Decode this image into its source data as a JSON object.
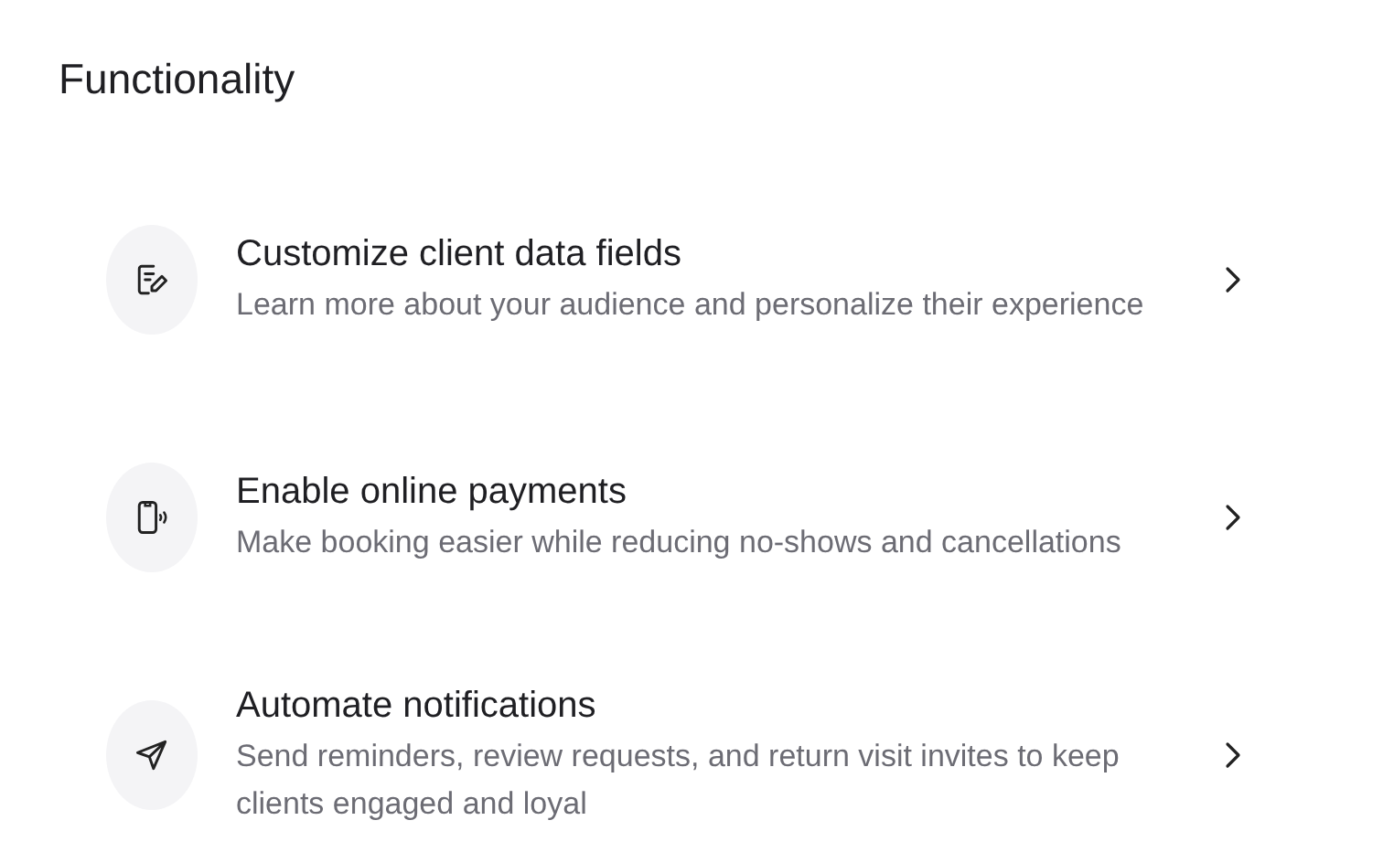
{
  "section": {
    "title": "Functionality"
  },
  "items": [
    {
      "kind": "form",
      "title": "Customize client data fields",
      "description": "Learn more about your audience and personalize their experience"
    },
    {
      "kind": "phone",
      "title": "Enable online payments",
      "description": "Make booking easier while reducing no-shows and cancellations"
    },
    {
      "kind": "send",
      "title": "Automate notifications",
      "description": "Send reminders, review requests, and return visit invites to keep clients engaged and loyal"
    }
  ]
}
